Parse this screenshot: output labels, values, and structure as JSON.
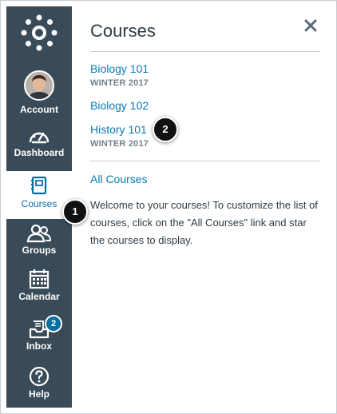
{
  "nav": {
    "items": [
      {
        "label": "Account",
        "icon": "avatar"
      },
      {
        "label": "Dashboard",
        "icon": "dashboard-icon"
      },
      {
        "label": "Courses",
        "icon": "courses-icon",
        "active": true
      },
      {
        "label": "Groups",
        "icon": "groups-icon"
      },
      {
        "label": "Calendar",
        "icon": "calendar-icon"
      },
      {
        "label": "Inbox",
        "icon": "inbox-icon",
        "badge": "2"
      },
      {
        "label": "Help",
        "icon": "help-icon"
      }
    ]
  },
  "tray": {
    "title": "Courses",
    "courses": [
      {
        "name": "Biology 101",
        "term": "WINTER 2017"
      },
      {
        "name": "Biology 102",
        "term": ""
      },
      {
        "name": "History 101",
        "term": "WINTER 2017"
      }
    ],
    "all_courses_label": "All Courses",
    "welcome_text": "Welcome to your courses! To customize the list of courses, click on the \"All Courses\" link and star the courses to display."
  },
  "callouts": [
    "1",
    "2"
  ],
  "colors": {
    "nav_bg": "#394b58",
    "link": "#0a7ab8",
    "active_text": "#0770a3",
    "badge": "#0770a3"
  }
}
